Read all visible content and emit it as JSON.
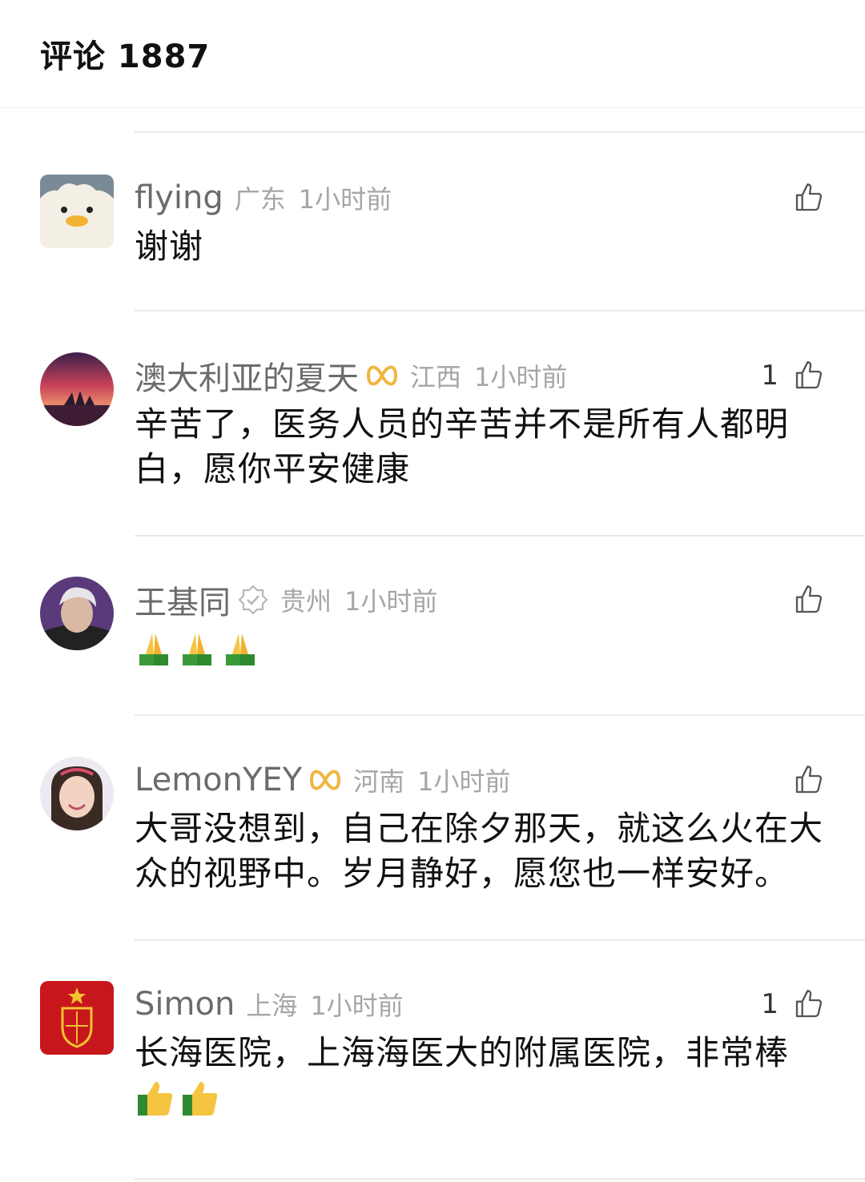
{
  "header": {
    "title": "评论 1887"
  },
  "comments": [
    {
      "username": "flying",
      "location": "广东",
      "time": "1小时前",
      "likes": "",
      "text": "谢谢",
      "avatar_icon": "duck-avatar-icon",
      "badge": ""
    },
    {
      "username": "澳大利亚的夏天",
      "location": "江西",
      "time": "1小时前",
      "likes": "1",
      "text": "辛苦了，医务人员的辛苦并不是所有人都明白，愿你平安健康",
      "avatar_icon": "sunset-opera-house-avatar-icon",
      "badge": "golden-loop-badge-icon"
    },
    {
      "username": "王基同",
      "location": "贵州",
      "time": "1小时前",
      "likes": "",
      "text": "",
      "emoji": [
        "praying-hands-emoji",
        "praying-hands-emoji",
        "praying-hands-emoji"
      ],
      "avatar_icon": "person-photo-avatar-icon",
      "badge": "verified-badge-icon"
    },
    {
      "username": "LemonYEY",
      "location": "河南",
      "time": "1小时前",
      "likes": "",
      "text": "大哥没想到，自己在除夕那天，就这么火在大众的视野中。岁月静好，愿您也一样安好。",
      "avatar_icon": "girl-photo-avatar-icon",
      "badge": "golden-loop-badge-icon"
    },
    {
      "username": "Simon",
      "location": "上海",
      "time": "1小时前",
      "likes": "1",
      "text": "长海医院，上海海医大的附属医院，非常棒",
      "emoji": [
        "thumbs-up-emoji",
        "thumbs-up-emoji"
      ],
      "avatar_icon": "spain-crest-avatar-icon",
      "badge": ""
    }
  ],
  "colors": {
    "username": "#6b6b6b",
    "meta": "#a6a6a6",
    "badge_gold": "#f0b642",
    "divider": "#e9e9e9"
  }
}
